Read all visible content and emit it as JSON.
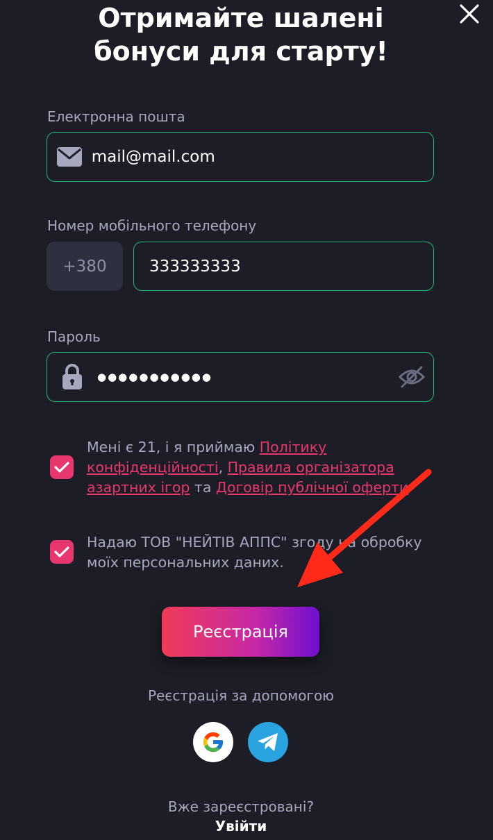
{
  "modal": {
    "title_line1": "Отримайте шалені",
    "title_line2": "бонуси для старту!"
  },
  "email": {
    "label": "Електронна пошта",
    "value": "mail@mail.com",
    "icon": "mail-icon"
  },
  "phone": {
    "label": "Номер мобільного телефону",
    "prefix": "+380",
    "value": "333333333"
  },
  "password": {
    "label": "Пароль",
    "value": "●●●●●●●●●●●",
    "lock_icon": "lock-icon",
    "visibility_icon": "eye-off-icon"
  },
  "consent": {
    "age": {
      "checked": true,
      "text_before": "Мені є 21, і я приймаю ",
      "link1": "Політику конфіденційності",
      "sep1": ", ",
      "link2": "Правила організатора азартних ігор",
      "sep2": " та ",
      "link3": "Договір публічної оферти"
    },
    "data": {
      "checked": true,
      "text": "Надаю ТОВ \"НЕЙТІВ АППС\" згоду на обробку моїх персональних даних."
    }
  },
  "register_button": {
    "label": "Реєстрація"
  },
  "social": {
    "label": "Реєстрація за допомогою",
    "providers": [
      "google-icon",
      "telegram-icon"
    ]
  },
  "footer": {
    "already_registered": "Вже зареєстровані?",
    "login": "Увійти"
  },
  "colors": {
    "background": "#1c1d26",
    "field_border": "#27b67c",
    "accent": "#e8366e",
    "muted_text": "#a7a8bd",
    "annotation_arrow": "#ff2a1a"
  }
}
